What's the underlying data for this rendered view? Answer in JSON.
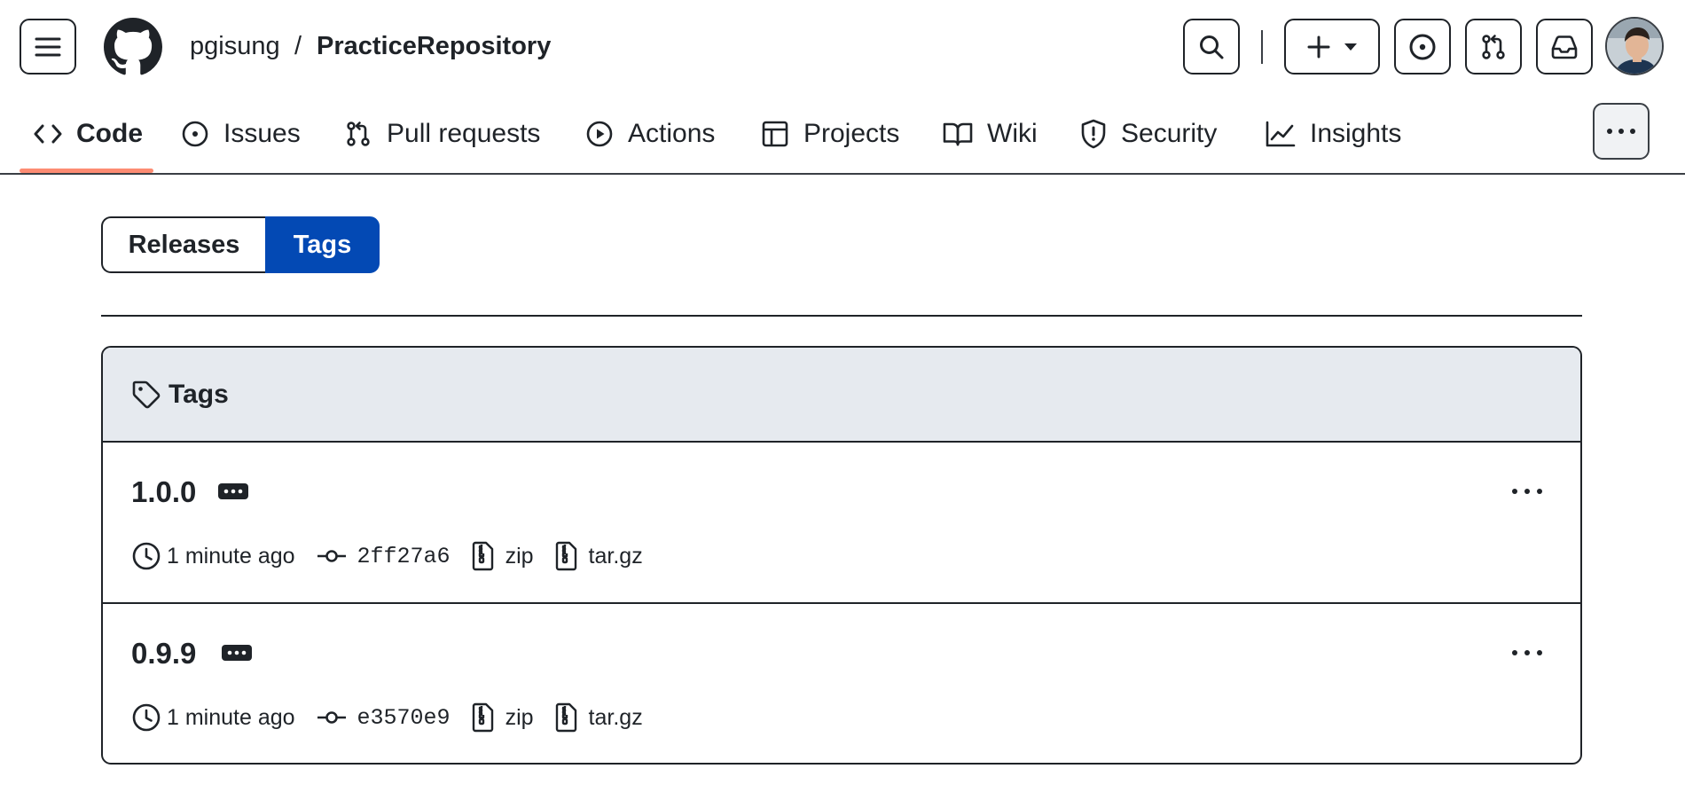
{
  "header": {
    "owner": "pgisung",
    "separator": "/",
    "repo": "PracticeRepository"
  },
  "nav": {
    "tabs": [
      {
        "label": "Code",
        "icon": "code-icon",
        "selected": true
      },
      {
        "label": "Issues",
        "icon": "issue-opened-icon"
      },
      {
        "label": "Pull requests",
        "icon": "git-pull-request-icon"
      },
      {
        "label": "Actions",
        "icon": "play-icon"
      },
      {
        "label": "Projects",
        "icon": "table-icon"
      },
      {
        "label": "Wiki",
        "icon": "book-icon"
      },
      {
        "label": "Security",
        "icon": "shield-icon"
      },
      {
        "label": "Insights",
        "icon": "graph-icon"
      }
    ]
  },
  "segmented": {
    "releases": "Releases",
    "tags": "Tags",
    "selected": "Tags"
  },
  "tags_box": {
    "title": "Tags",
    "rows": [
      {
        "name": "1.0.0",
        "time": "1 minute ago",
        "commit": "2ff27a6",
        "zip": "zip",
        "targz": "tar.gz"
      },
      {
        "name": "0.9.9",
        "time": "1 minute ago",
        "commit": "e3570e9",
        "zip": "zip",
        "targz": "tar.gz"
      }
    ]
  },
  "colors": {
    "accent": "#0349b4",
    "selected_underline": "#fd8c73",
    "header_bg": "#e6eaef",
    "text": "#1f2328"
  }
}
